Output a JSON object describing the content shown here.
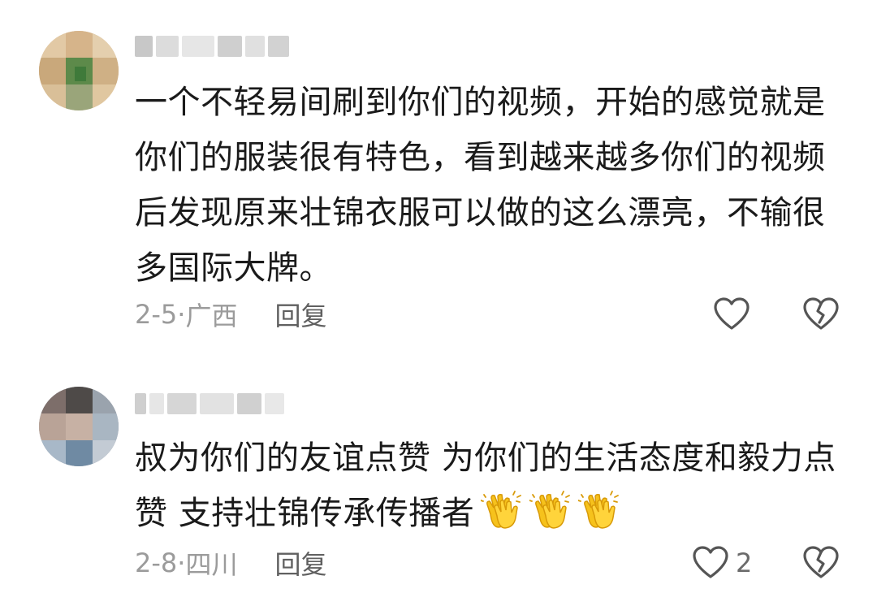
{
  "comments": [
    {
      "text": "一个不轻易间刷到你们的视频，开始的感觉就是你们的服装很有特色，看到越来越多你们的视频后发现原来壮锦衣服可以做的这么漂亮，不输很多国际大牌。",
      "date": "2-5",
      "location": "广西",
      "reply_label": "回复",
      "like_count": ""
    },
    {
      "text": "叔为你们的友谊点赞 为你们的生活态度和毅力点赞 支持壮锦传承传播者",
      "emoji": [
        "clapping-hands",
        "clapping-hands",
        "clapping-hands"
      ],
      "date": "2-8",
      "location": "四川",
      "reply_label": "回复",
      "like_count": "2"
    }
  ],
  "colors": {
    "meta_gray": "#9b9b9b",
    "icon_stroke": "#555555",
    "emoji_yellow": "#f6c21c"
  }
}
